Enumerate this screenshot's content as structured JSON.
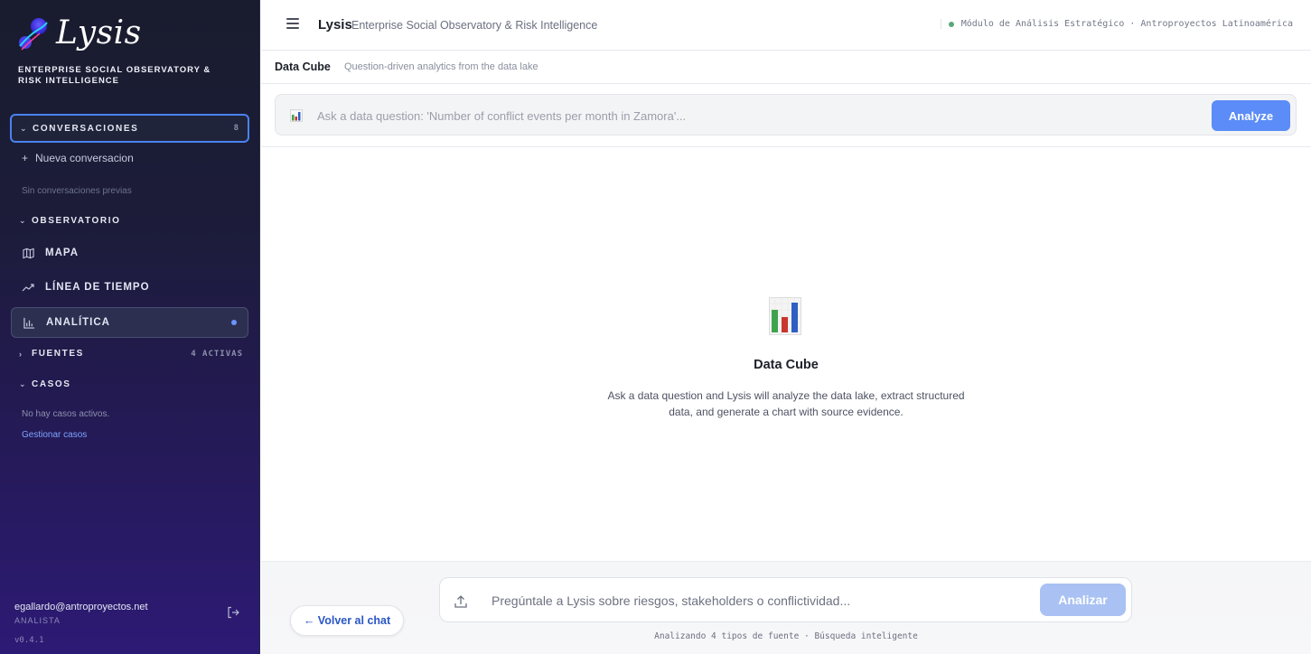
{
  "brand": {
    "name": "Lysis",
    "tagline": "ENTERPRISE SOCIAL OBSERVATORY & RISK INTELLIGENCE"
  },
  "sidebar": {
    "conversations": {
      "label": "CONVERSACIONES",
      "count": "8",
      "new_label": "Nueva conversacion",
      "empty": "Sin conversaciones previas"
    },
    "observatory": {
      "label": "OBSERVATORIO",
      "items": [
        {
          "label": "MAPA",
          "icon": "map-icon"
        },
        {
          "label": "LÍNEA DE TIEMPO",
          "icon": "trend-icon"
        },
        {
          "label": "ANALÍTICA",
          "icon": "bar-chart-icon",
          "active": true
        }
      ]
    },
    "sources": {
      "label": "FUENTES",
      "status": "4 ACTIVAS"
    },
    "cases": {
      "label": "CASOS",
      "empty": "No hay casos activos.",
      "manage_link": "Gestionar casos"
    },
    "user": {
      "email": "egallardo@antroproyectos.net",
      "role": "ANALISTA",
      "version": "v0.4.1"
    }
  },
  "header": {
    "title": "Lysis",
    "subtitle": "Enterprise Social Observatory & Risk Intelligence",
    "module": "Módulo de Análisis Estratégico · Antroproyectos Latinoamérica"
  },
  "data_cube": {
    "title": "Data Cube",
    "description": "Question-driven analytics from the data lake",
    "query_placeholder": "Ask a data question: 'Number of conflict events per month in Zamora'...",
    "analyze_label": "Analyze",
    "empty_title": "Data Cube",
    "empty_text": "Ask a data question and Lysis will analyze the data lake, extract structured data, and generate a chart with source evidence."
  },
  "chat": {
    "back_label": "← Volver al chat",
    "placeholder": "Pregúntale a Lysis sobre riesgos, stakeholders o conflictividad...",
    "submit_label": "Analizar",
    "note": "Analizando 4 tipos de fuente · Búsqueda inteligente"
  },
  "colors": {
    "accent": "#5b8cf7",
    "active_dot": "#6b94ff",
    "status_green": "#5aa77a"
  }
}
